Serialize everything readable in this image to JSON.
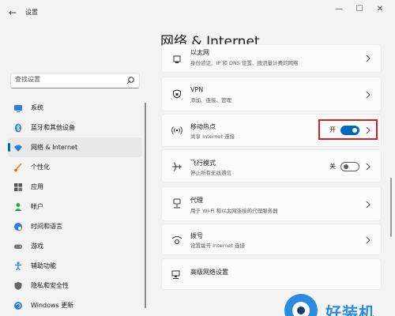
{
  "window": {
    "app_title": "设置",
    "back_glyph": "←",
    "minimize_glyph": "—",
    "maximize_glyph": "☐",
    "close_glyph": "✕"
  },
  "page_title": "网络 & Internet",
  "search": {
    "placeholder": "查找设置"
  },
  "sidebar": {
    "items": [
      {
        "label": "系统",
        "icon": "monitor-icon",
        "selected": false
      },
      {
        "label": "蓝牙和其他设备",
        "icon": "bluetooth-icon",
        "selected": false
      },
      {
        "label": "网络 & Internet",
        "icon": "wifi-icon",
        "selected": true
      },
      {
        "label": "个性化",
        "icon": "brush-icon",
        "selected": false
      },
      {
        "label": "应用",
        "icon": "apps-icon",
        "selected": false
      },
      {
        "label": "帐户",
        "icon": "person-icon",
        "selected": false
      },
      {
        "label": "时间和语言",
        "icon": "globe-clock-icon",
        "selected": false
      },
      {
        "label": "游戏",
        "icon": "gamepad-icon",
        "selected": false
      },
      {
        "label": "辅助功能",
        "icon": "accessibility-icon",
        "selected": false
      },
      {
        "label": "隐私和安全性",
        "icon": "shield-icon",
        "selected": false
      },
      {
        "label": "Windows 更新",
        "icon": "update-icon",
        "selected": false
      }
    ]
  },
  "cards": {
    "ethernet": {
      "title": "以太网",
      "subtitle": "身份验证、IP 和 DNS 设置、按流量计费的网络"
    },
    "vpn": {
      "title": "VPN",
      "subtitle": "添加、连接、管理"
    },
    "hotspot": {
      "title": "移动热点",
      "subtitle": "共享 Internet 连接",
      "toggle_label": "开",
      "toggle_on": true
    },
    "airplane": {
      "title": "飞行模式",
      "subtitle": "停止所有无线通信",
      "toggle_label": "关",
      "toggle_on": false
    },
    "proxy": {
      "title": "代理",
      "subtitle": "用于 Wi-Fi 和以太网连接的代理服务器"
    },
    "dialup": {
      "title": "拨号",
      "subtitle": "设置拨号 Internet 连接"
    },
    "advanced": {
      "title": "高级网络设置"
    }
  },
  "watermark": {
    "text": "好装机"
  },
  "colors": {
    "accent": "#0067c0",
    "highlight": "#d32020",
    "watermark": "#2a8be0"
  }
}
